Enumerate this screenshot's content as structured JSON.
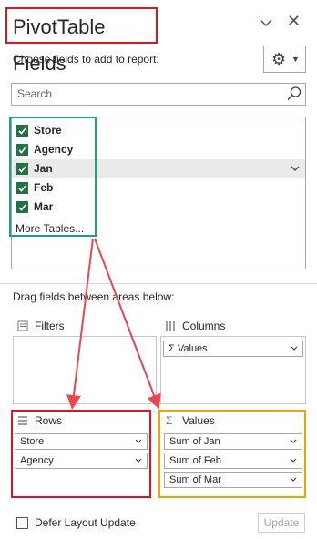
{
  "panel": {
    "title": "PivotTable Fields",
    "subtitle": "Choose fields to add to report:",
    "settings_icon": "gear-icon",
    "close_icon": "close-icon"
  },
  "search": {
    "placeholder": "Search"
  },
  "fields": [
    {
      "label": "Store",
      "checked": true
    },
    {
      "label": "Agency",
      "checked": true
    },
    {
      "label": "Jan",
      "checked": true
    },
    {
      "label": "Feb",
      "checked": true
    },
    {
      "label": "Mar",
      "checked": true
    }
  ],
  "more_tables": "More Tables...",
  "drag_hint": "Drag fields between areas below:",
  "areas": {
    "filters": {
      "label": "Filters",
      "items": []
    },
    "columns": {
      "label": "Columns",
      "items": [
        "Σ Values"
      ]
    },
    "rows": {
      "label": "Rows",
      "items": [
        "Store",
        "Agency"
      ]
    },
    "values": {
      "label": "Values",
      "items": [
        "Sum of Jan",
        "Sum of Feb",
        "Sum of Mar"
      ]
    }
  },
  "footer": {
    "defer_label": "Defer Layout Update",
    "update_label": "Update"
  },
  "annotation_colors": {
    "red": "#e0141e",
    "teal": "#1aa08d",
    "orange": "#f2a300",
    "arrow": "#e8474f"
  }
}
